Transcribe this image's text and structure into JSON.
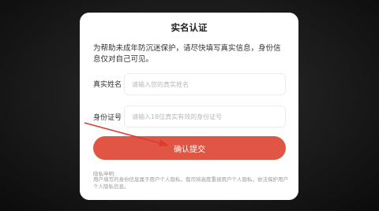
{
  "dialog": {
    "title": "实名认证",
    "description": "为帮助未成年防沉迷保护，请尽快填写真实信息，身份信息仅对自己可见。",
    "name_field": {
      "label": "真实姓名",
      "placeholder": "请输入您的真实姓名",
      "value": ""
    },
    "id_field": {
      "label": "身份证号",
      "placeholder": "请输入18位真实有效的身份证号",
      "value": ""
    },
    "submit_label": "确认提交",
    "privacy_title": "隐私申明:",
    "privacy_text": "用户填写的身份信息属于用户个人隐私，我司将高度重视用户个人隐私，依法保护用户个人隐私信息。"
  },
  "colors": {
    "accent": "#e05543",
    "annotation_arrow": "#e03a30",
    "overlay": "#1a1a1a"
  }
}
